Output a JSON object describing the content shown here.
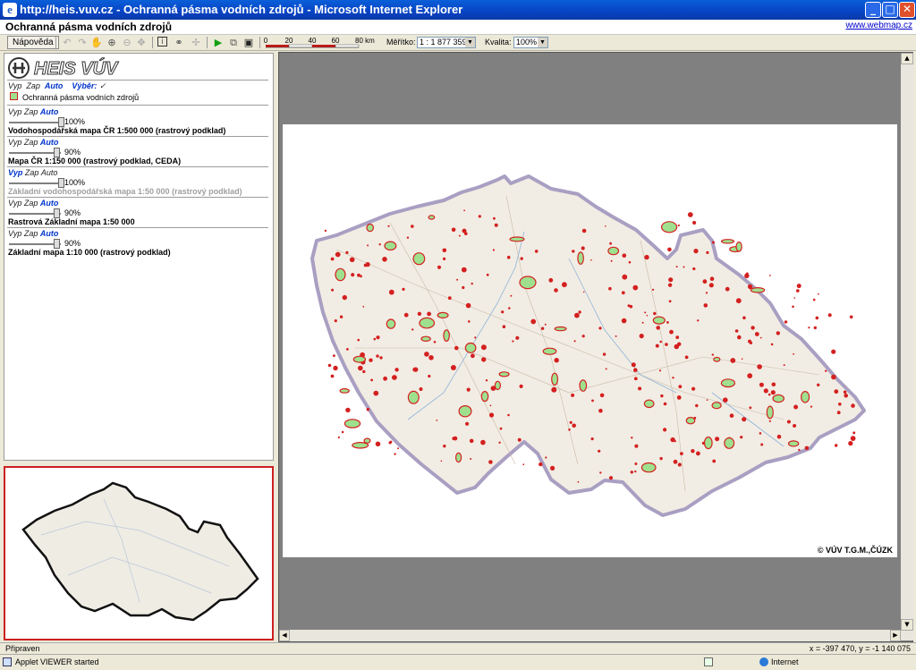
{
  "window": {
    "title": "http://heis.vuv.cz - Ochranná pásma vodních zdrojů - Microsoft Internet Explorer",
    "min_glyph": "_",
    "max_glyph": "□",
    "close_glyph": "✕"
  },
  "header": {
    "title": "Ochranná pásma vodních zdrojů",
    "link": "www.webmap.cz"
  },
  "toolbar": {
    "help_label": "Nápověda",
    "scale_ticks": [
      "0",
      "20",
      "40",
      "60",
      "80 km"
    ],
    "scale_label": "Měřítko:",
    "scale_value": "1 : 1 877 359",
    "quality_label": "Kvalita:",
    "quality_value": "100%"
  },
  "panel": {
    "logo": "HEIS VÚV",
    "opt_off": "Vyp",
    "opt_on": "Zap",
    "opt_auto": "Auto",
    "selection_label": "Výběr:",
    "selection_check": "✓",
    "top_layer": "Ochranná pásma vodních zdrojů",
    "layers": [
      {
        "pct": "100%",
        "name": "Vodohospodářská mapa ČR 1:500 000 (rastrový podklad)",
        "pct_value": 1.0,
        "active": "Auto",
        "dim": false
      },
      {
        "pct": "90%",
        "name": "Mapa ČR 1:150 000 (rastrový podklad, CEDA)",
        "pct_value": 0.9,
        "active": "Auto",
        "dim": false
      },
      {
        "pct": "100%",
        "name": "Základní vodohospodářská mapa 1:50 000 (rastrový podklad)",
        "pct_value": 1.0,
        "active": "Vyp",
        "dim": true
      },
      {
        "pct": "90%",
        "name": "Rastrová Základní mapa 1:50 000",
        "pct_value": 0.9,
        "active": "Auto",
        "dim": false
      },
      {
        "pct": "90%",
        "name": "Základní mapa 1:10 000 (rastrový podklad)",
        "pct_value": 0.9,
        "active": "Auto",
        "dim": false
      }
    ]
  },
  "map": {
    "copyright": "© VÚV T.G.M.,ČÚZK"
  },
  "status": {
    "ready": "Připraven",
    "coords": "x = -397 470, y = -1 140 075",
    "applet": "Applet VIEWER started",
    "zone": "Internet"
  },
  "colors": {
    "zone_red": "#d42020",
    "zone_green": "#9fe08f",
    "border": "#9a8fb0",
    "overview_border": "#cc2020"
  }
}
